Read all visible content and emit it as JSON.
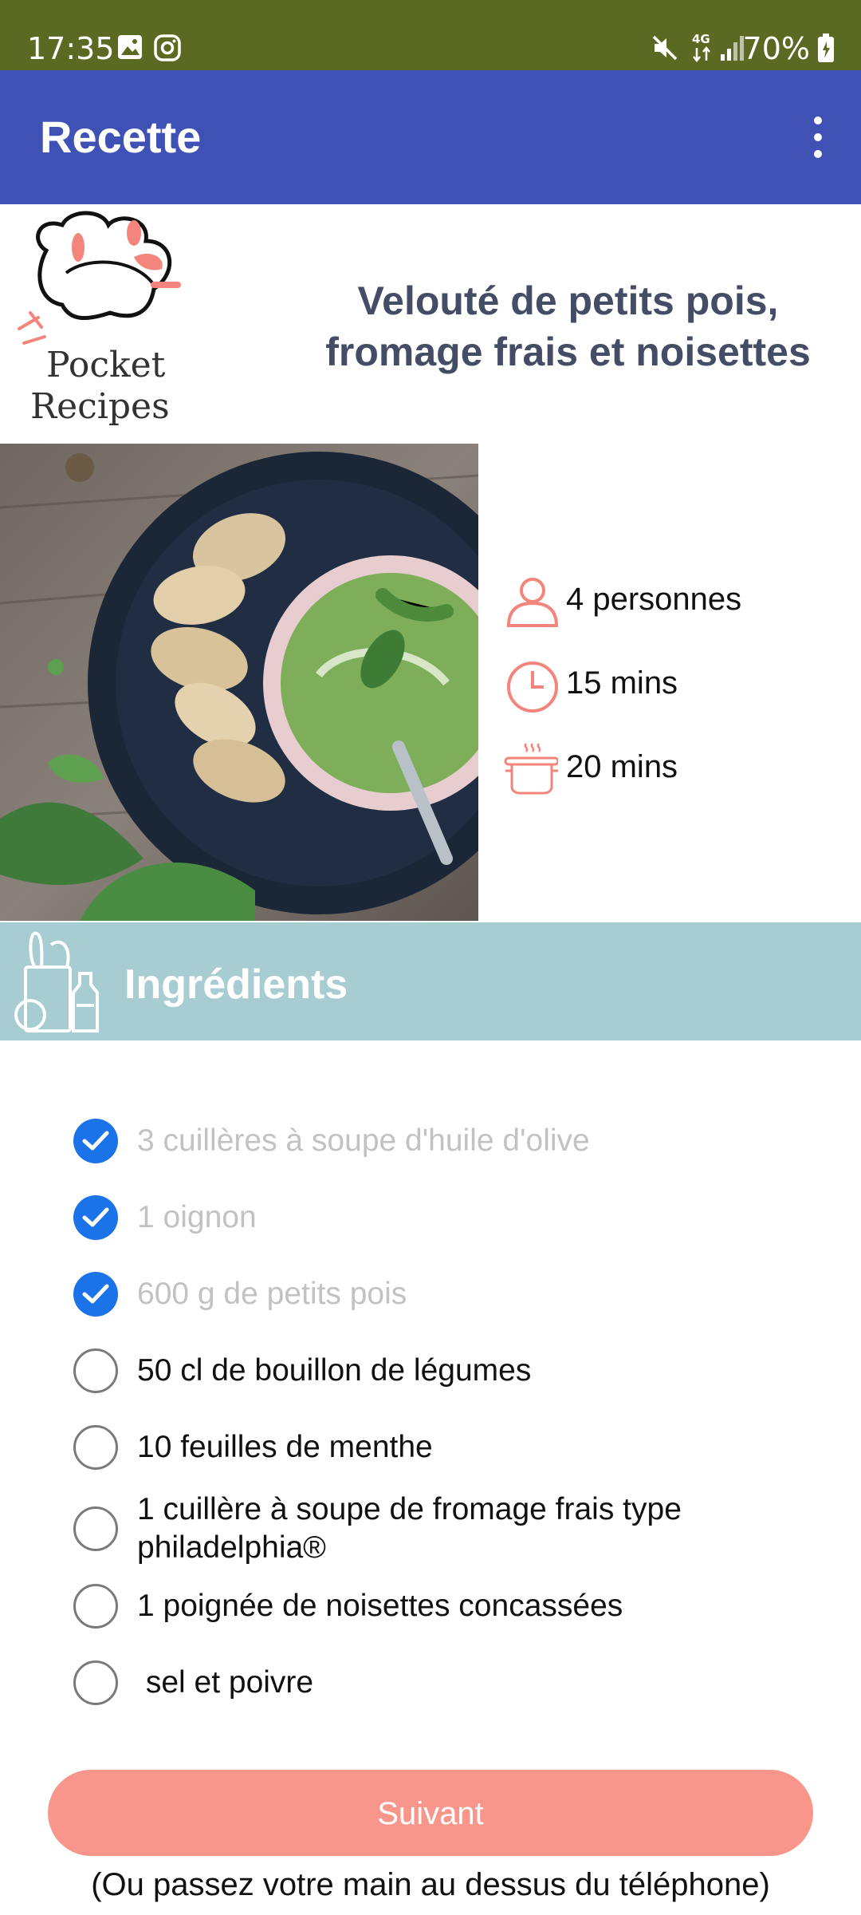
{
  "status_bar": {
    "time": "17:35",
    "battery": "70%",
    "network": "4G"
  },
  "app_bar": {
    "title": "Recette"
  },
  "logo": {
    "line1": "Pocket",
    "line2": "Recipes"
  },
  "recipe": {
    "title_line1": "Velouté de petits pois,",
    "title_line2": "fromage frais et noisettes",
    "servings": "4 personnes",
    "prep_time": "15 mins",
    "cook_time": "20 mins"
  },
  "ingredients": {
    "header": "Ingrédients",
    "items": [
      {
        "text": "3 cuillères à soupe d'huile d'olive",
        "checked": true
      },
      {
        "text": "1 oignon",
        "checked": true
      },
      {
        "text": "600 g de petits pois",
        "checked": true
      },
      {
        "text": "50 cl de bouillon de légumes",
        "checked": false
      },
      {
        "text": "10 feuilles de menthe",
        "checked": false
      },
      {
        "text": "1 cuillère à soupe de fromage frais type philadelphia®",
        "checked": false
      },
      {
        "text": "1 poignée de noisettes concassées",
        "checked": false
      },
      {
        "text": " sel et poivre",
        "checked": false
      }
    ]
  },
  "footer": {
    "next_label": "Suivant",
    "hint": "(Ou passez votre main au dessus du téléphone)"
  },
  "colors": {
    "status_bar": "#5a6a22",
    "app_bar": "#3f51b5",
    "accent": "#f9968b",
    "checkbox": "#1a73e8",
    "ingredients_header": "#a7cdd3",
    "title": "#454d66"
  }
}
